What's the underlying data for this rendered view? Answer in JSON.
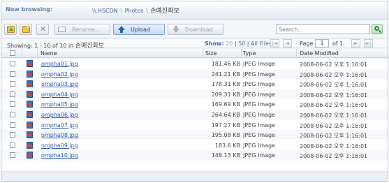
{
  "header": {
    "now_browsing_label": "Now browsing:",
    "breadcrumb": {
      "root": "\\\\.HSCDN",
      "sep": "\\",
      "folder": "Photos",
      "current": "손예진화보"
    }
  },
  "toolbar": {
    "folder_up_icon": "folder-up-icon",
    "new_folder_icon": "new-folder-icon",
    "delete_icon": "delete-icon",
    "rename_label": "Rename...",
    "upload_label": "Upload",
    "download_label": "Download",
    "search_placeholder": "Search..."
  },
  "status": {
    "showing_prefix": "Showing: 1 - 10 of 10 in ",
    "showing_folder": "손예진화보",
    "show_label": "Show:",
    "show_options": [
      "20",
      "50",
      "All Files"
    ],
    "page_label": "Page",
    "page_value": "1",
    "page_of": "of 1"
  },
  "columns": {
    "name": "Name",
    "size": "Size",
    "type": "Type",
    "date": "Date Modified"
  },
  "rows": [
    {
      "name": "ompha01.jpg",
      "size": "181.46 KB",
      "type": "JPEG Image",
      "date": "2008-06-02 오후 1:16:01"
    },
    {
      "name": "ompha02.jpg",
      "size": "241.21 KB",
      "type": "JPEG Image",
      "date": "2008-06-02 오후 1:16:01"
    },
    {
      "name": "ompha03.jpg",
      "size": "178.31 KB",
      "type": "JPEG Image",
      "date": "2008-06-02 오후 1:16:01"
    },
    {
      "name": "ompha04.jpg",
      "size": "209.31 KB",
      "type": "JPEG Image",
      "date": "2008-06-02 오후 1:16:01"
    },
    {
      "name": "ompha05.jpg",
      "size": "169.69 KB",
      "type": "JPEG Image",
      "date": "2008-06-02 오후 1:16:01"
    },
    {
      "name": "ompha06.jpg",
      "size": "264.64 KB",
      "type": "JPEG Image",
      "date": "2008-06-02 오후 1:16:01"
    },
    {
      "name": "ompha07.jpg",
      "size": "197.27 KB",
      "type": "JPEG Image",
      "date": "2008-06-02 오후 1:16:01"
    },
    {
      "name": "ompha08.jpg",
      "size": "195.08 KB",
      "type": "JPEG Image",
      "date": "2008-06-02 오후 1:16:01"
    },
    {
      "name": "ompha09.jpg",
      "size": "183.6 KB",
      "type": "JPEG Image",
      "date": "2008-06-02 오후 1:16:01"
    },
    {
      "name": "ompha10.jpg",
      "size": "148.13 KB",
      "type": "JPEG Image",
      "date": "2008-06-02 오후 1:16:01"
    }
  ],
  "colors": {
    "accent": "#3b6aa5",
    "link": "#2a5db0",
    "upload_button": "#c5d9ef"
  }
}
